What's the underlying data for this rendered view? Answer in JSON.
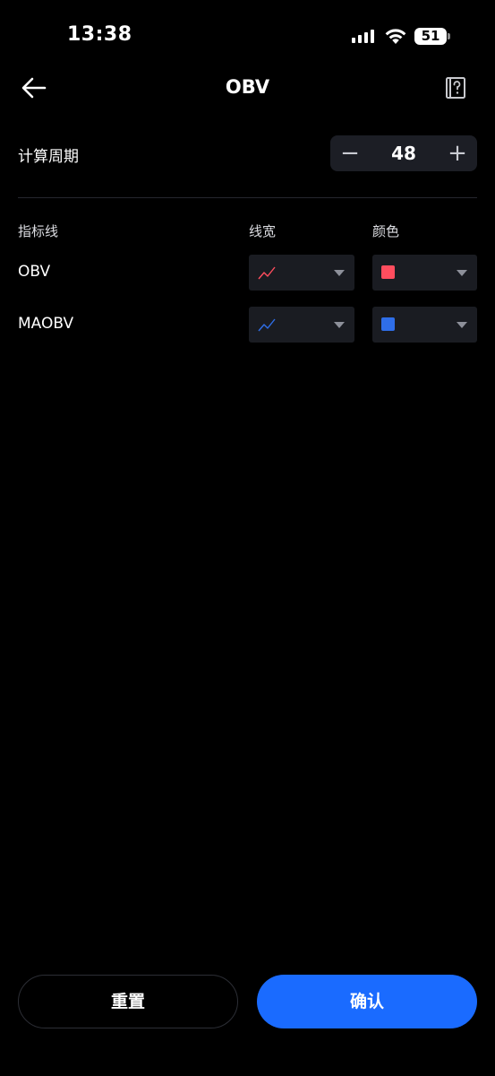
{
  "status_bar": {
    "time": "13:38",
    "battery_level": "51",
    "icons": [
      "signal-icon",
      "wifi-icon",
      "battery-icon"
    ]
  },
  "header": {
    "title": "OBV",
    "back_icon": "arrow-left-icon",
    "help_icon": "help-book-icon"
  },
  "period": {
    "label": "计算周期",
    "value": "48",
    "decrement_icon": "minus-icon",
    "increment_icon": "plus-icon"
  },
  "table": {
    "headers": {
      "indicator": "指标线",
      "width": "线宽",
      "color": "颜色"
    },
    "rows": [
      {
        "label": "OBV",
        "line_color": "#ff4d5e",
        "swatch_color": "#ff4d5e"
      },
      {
        "label": "MAOBV",
        "line_color": "#2f6ee8",
        "swatch_color": "#2f6ee8"
      }
    ]
  },
  "actions": {
    "reset": "重置",
    "confirm": "确认"
  },
  "colors": {
    "background": "#000000",
    "accent": "#1a6bff",
    "control_bg": "#1c1e25"
  }
}
